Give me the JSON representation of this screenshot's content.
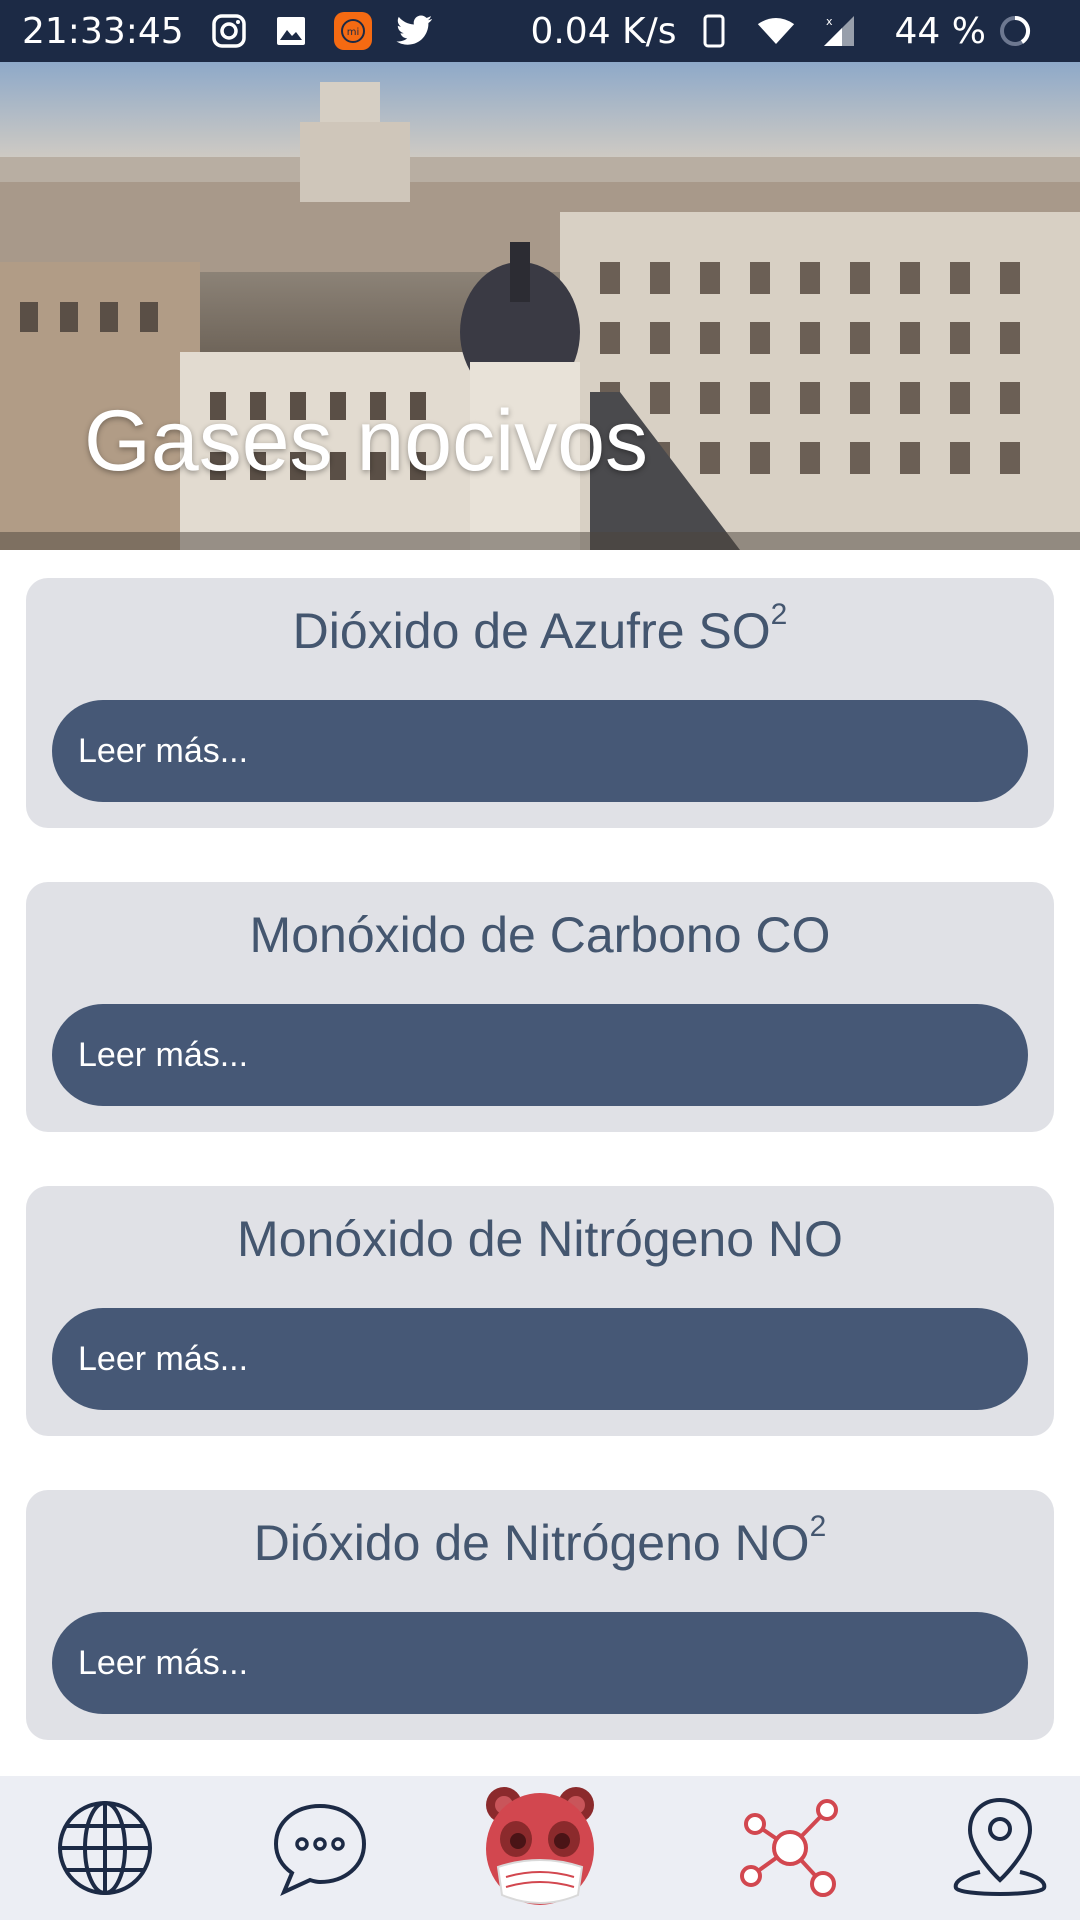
{
  "status_bar": {
    "time": "21:33:45",
    "speed": "0.04 K/s",
    "battery": "44 %",
    "icons": [
      "instagram-icon",
      "gallery-icon",
      "mi-icon",
      "twitter-icon",
      "phone-icon",
      "wifi-icon",
      "signal-icon",
      "battery-ring-icon"
    ]
  },
  "hero": {
    "title": "Gases nocivos"
  },
  "gases": [
    {
      "name": "Dióxido de Azufre  SO",
      "sup": "2",
      "button": "Leer más..."
    },
    {
      "name": "Monóxido de Carbono  CO",
      "sup": "",
      "button": "Leer más..."
    },
    {
      "name": "Monóxido de Nitrógeno NO",
      "sup": "",
      "button": "Leer más..."
    },
    {
      "name": "Dióxido de Nitrógeno  NO",
      "sup": "2",
      "button": "Leer más..."
    }
  ],
  "bottom_nav": {
    "items": [
      "globe-icon",
      "chat-icon",
      "bear-mascot-icon",
      "molecule-icon",
      "location-pin-icon"
    ]
  },
  "colors": {
    "status_bar": "#1c2a45",
    "card_bg": "#e0e1e6",
    "button": "#465876",
    "title_text": "#44566f",
    "accent_red": "#d2474f"
  }
}
